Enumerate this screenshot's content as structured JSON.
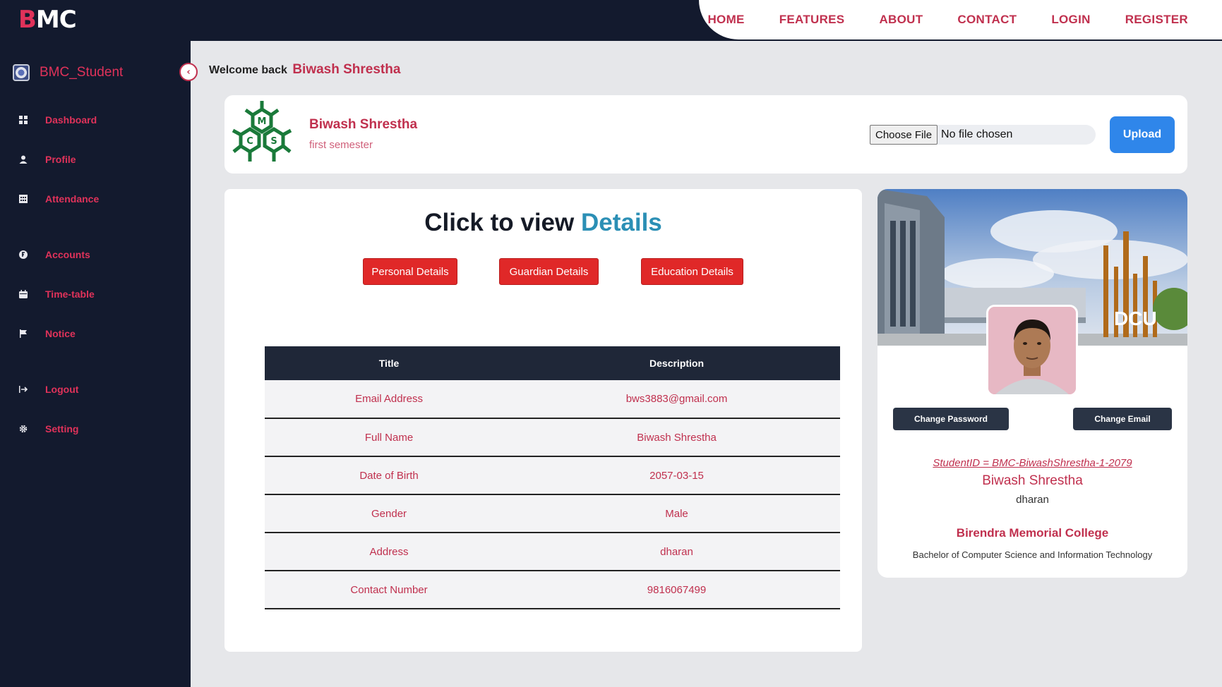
{
  "brand": {
    "logo_part1": "B",
    "logo_part2": "MC"
  },
  "nav": [
    "HOME",
    "FEATURES",
    "ABOUT",
    "CONTACT",
    "LOGIN",
    "REGISTER"
  ],
  "sidebar": {
    "title": "BMC_Student",
    "items": [
      {
        "label": "Dashboard",
        "icon": "grid-icon"
      },
      {
        "label": "Profile",
        "icon": "user-icon"
      },
      {
        "label": "Attendance",
        "icon": "calendar-grid-icon"
      },
      {
        "label": "Accounts",
        "icon": "coin-icon"
      },
      {
        "label": "Time-table",
        "icon": "calendar-icon"
      },
      {
        "label": "Notice",
        "icon": "flag-icon"
      },
      {
        "label": "Logout",
        "icon": "logout-icon"
      },
      {
        "label": "Setting",
        "icon": "gear-icon"
      }
    ]
  },
  "welcome": {
    "prefix": "Welcome back",
    "name": "Biwash Shrestha"
  },
  "profile": {
    "name": "Biwash Shrestha",
    "semester": "first semester",
    "file_button": "Choose File",
    "file_status": "No file chosen",
    "upload_label": "Upload"
  },
  "details": {
    "title_prefix": "Click to view",
    "title_highlight": "Details",
    "buttons": [
      "Personal Details",
      "Guardian Details",
      "Education Details"
    ],
    "table": {
      "headers": [
        "Title",
        "Description"
      ],
      "rows": [
        [
          "Email Address",
          "bws3883@gmail.com"
        ],
        [
          "Full Name",
          "Biwash Shrestha"
        ],
        [
          "Date of Birth",
          "2057-03-15"
        ],
        [
          "Gender",
          "Male"
        ],
        [
          "Address",
          "dharan"
        ],
        [
          "Contact Number",
          "9816067499"
        ]
      ]
    }
  },
  "id_card": {
    "banner_text": "DCU",
    "change_password": "Change Password",
    "change_email": "Change Email",
    "student_id": "StudentID = BMC-BiwashShrestha-1-2079",
    "name": "Biwash Shrestha",
    "city": "dharan",
    "college": "Birendra Memorial College",
    "course": "Bachelor of Computer Science and Information Technology"
  },
  "colors": {
    "accent": "#c0304e",
    "sidebar": "#131a2e",
    "button_red": "#e02828",
    "upload_blue": "#2f86ea",
    "highlight": "#2b8fb5"
  }
}
